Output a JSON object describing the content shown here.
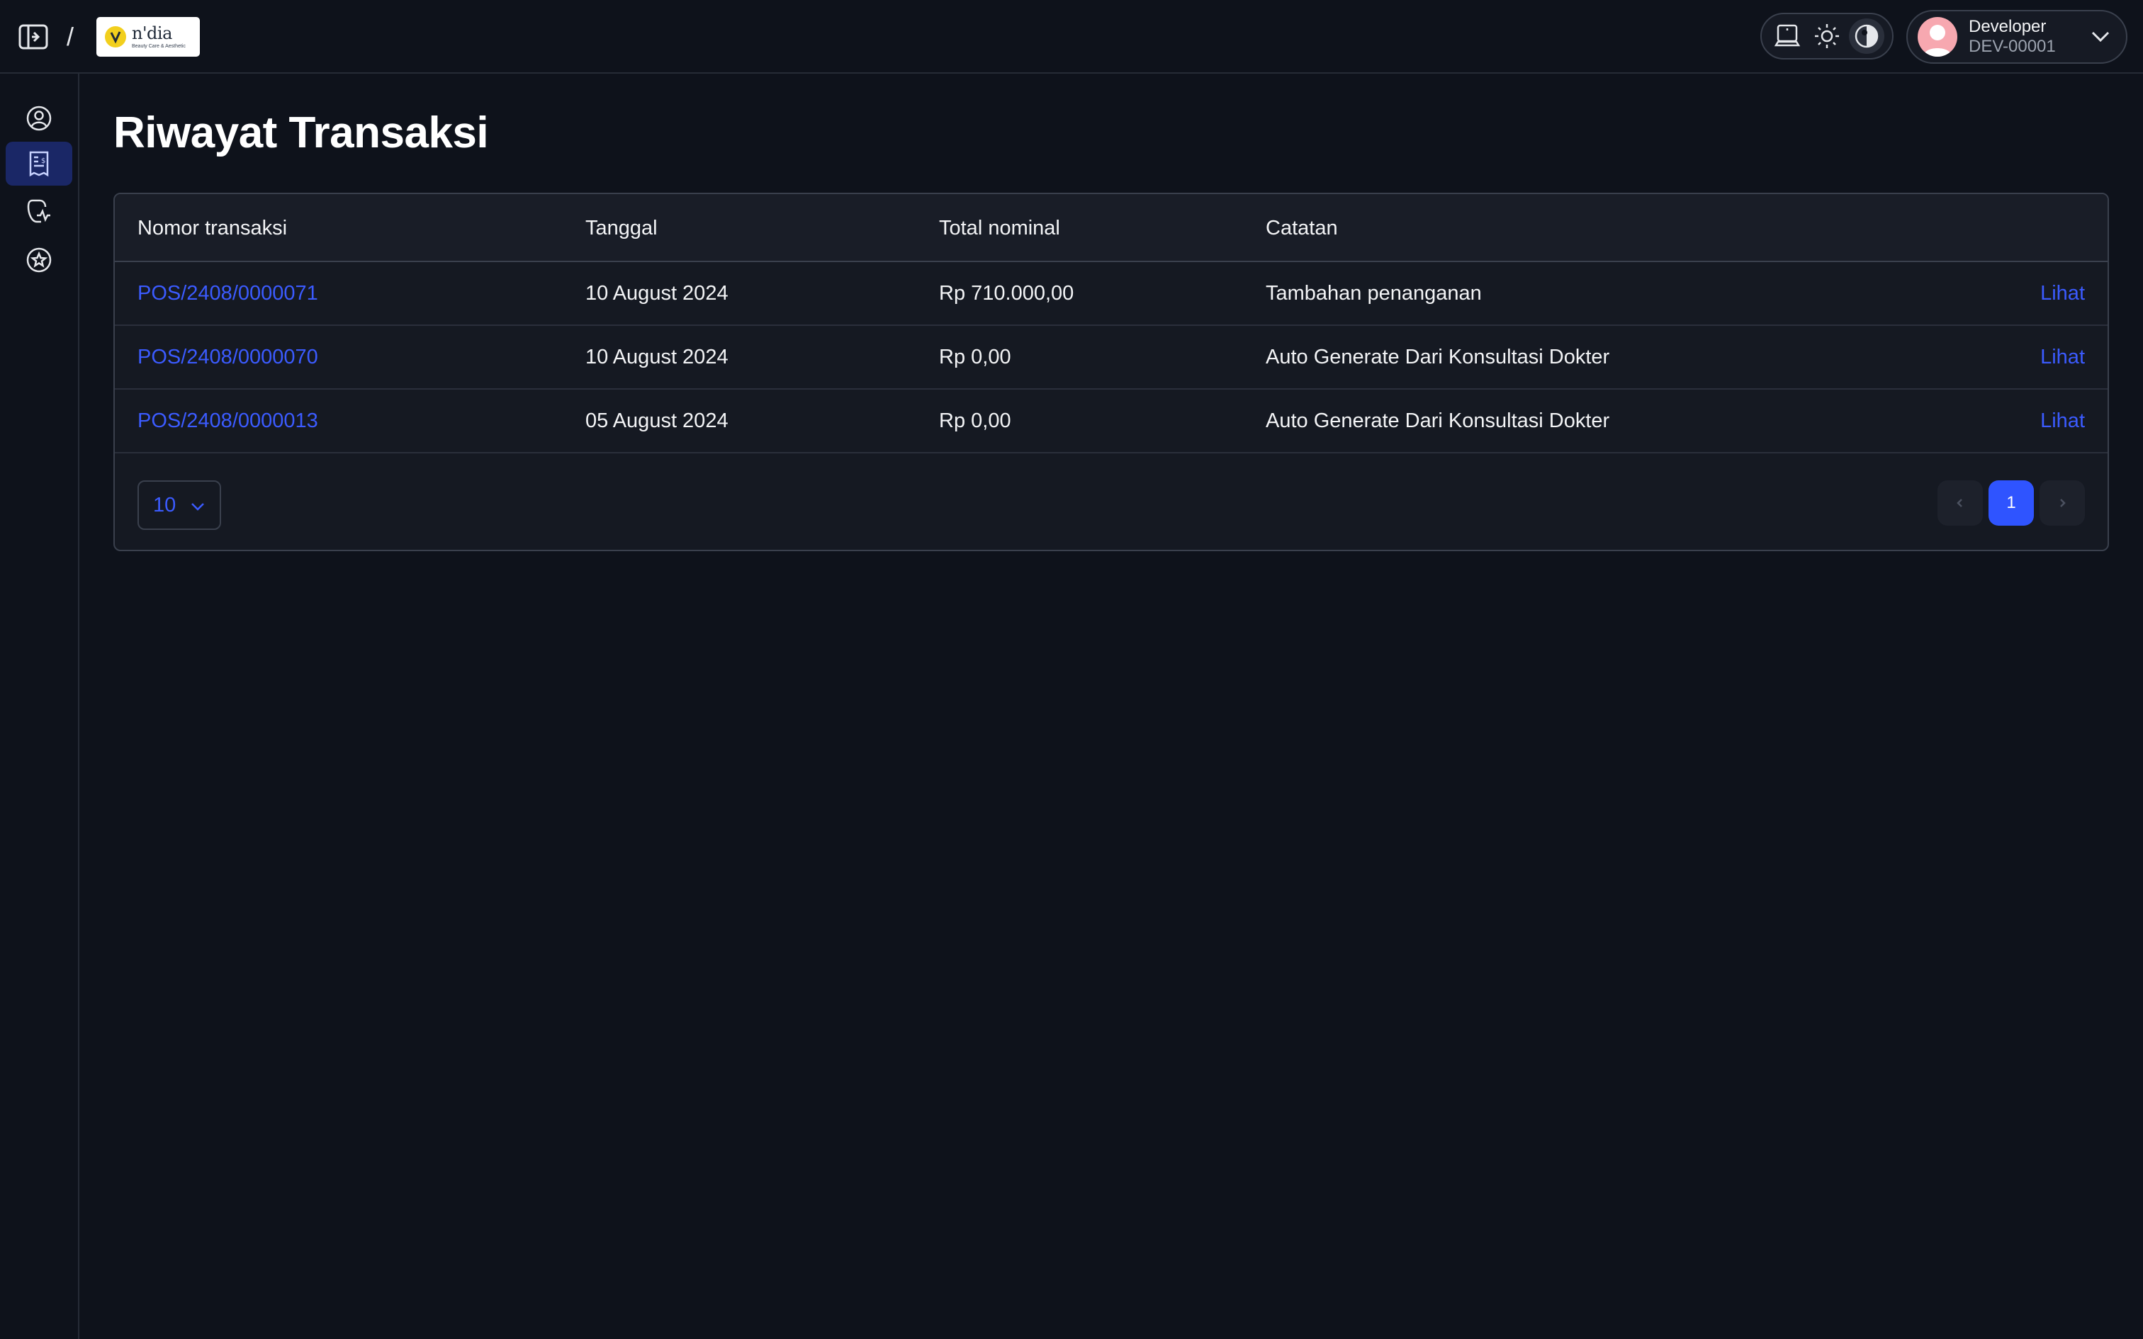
{
  "header": {
    "breadcrumb_separator": "/",
    "logo": {
      "name": "n'dia",
      "tagline": "Beauty Care & Aesthetic"
    },
    "theme_icons": [
      "laptop-icon",
      "sun-icon",
      "contrast-icon"
    ],
    "user": {
      "name": "Developer",
      "id": "DEV-00001"
    }
  },
  "sidebar": {
    "items": [
      {
        "icon": "user-circle-icon",
        "active": false
      },
      {
        "icon": "receipt-icon",
        "active": true
      },
      {
        "icon": "health-report-icon",
        "active": false
      },
      {
        "icon": "star-badge-icon",
        "active": false
      }
    ]
  },
  "page": {
    "title": "Riwayat Transaksi"
  },
  "table": {
    "columns": [
      "Nomor transaksi",
      "Tanggal",
      "Total nominal",
      "Catatan"
    ],
    "rows": [
      {
        "number": "POS/2408/0000071",
        "date": "10 August 2024",
        "total": "Rp 710.000,00",
        "note": "Tambahan penanganan",
        "action": "Lihat"
      },
      {
        "number": "POS/2408/0000070",
        "date": "10 August 2024",
        "total": "Rp 0,00",
        "note": "Auto Generate Dari Konsultasi Dokter",
        "action": "Lihat"
      },
      {
        "number": "POS/2408/0000013",
        "date": "05 August 2024",
        "total": "Rp 0,00",
        "note": "Auto Generate Dari Konsultasi Dokter",
        "action": "Lihat"
      }
    ]
  },
  "pagination": {
    "per_page": "10",
    "current_page": "1"
  },
  "colors": {
    "background": "#0e121b",
    "accent": "#3b5bff",
    "active_page": "#2f54ff",
    "active_nav": "#1a2766"
  }
}
